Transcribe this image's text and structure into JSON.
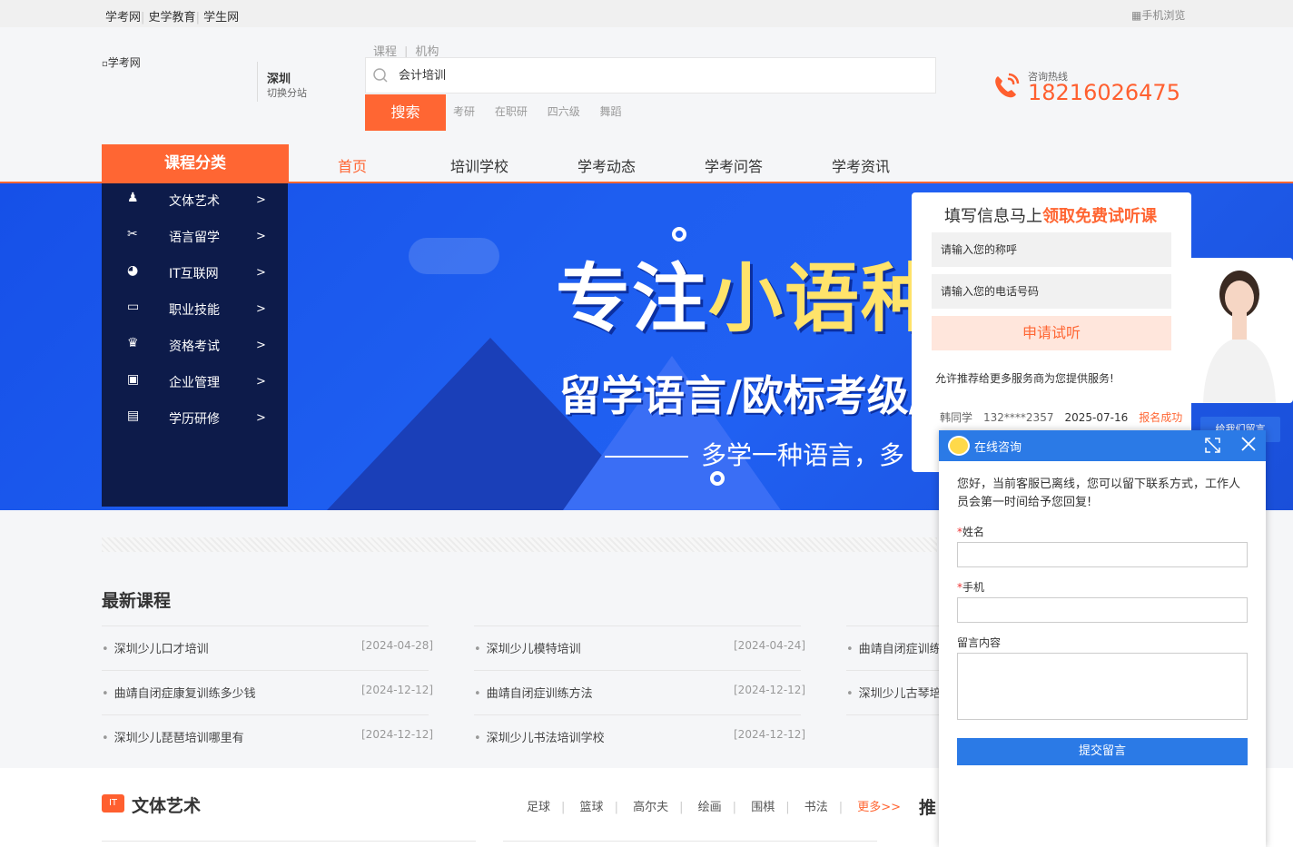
{
  "topbar": {
    "links": [
      "学考网",
      "史学教育",
      "学生网"
    ],
    "mobile": "手机浏览"
  },
  "header": {
    "logo_alt": "学考网",
    "city": "深圳",
    "city_switch": "切换分站",
    "search_tabs": [
      "课程",
      "机构"
    ],
    "search_value": "会计培训",
    "search_button": "搜索",
    "hot_keywords": [
      "考研",
      "在职研",
      "四六级",
      "舞蹈"
    ],
    "hotline_label": "咨询热线",
    "hotline_number": "18216026475"
  },
  "nav": {
    "category": "课程分类",
    "items": [
      "首页",
      "培训学校",
      "学考动态",
      "学考问答",
      "学考资讯"
    ]
  },
  "sidebar": {
    "items": [
      {
        "label": "文体艺术",
        "icon": "person-icon"
      },
      {
        "label": "语言留学",
        "icon": "tools-icon"
      },
      {
        "label": "IT互联网",
        "icon": "globe-icon"
      },
      {
        "label": "职业技能",
        "icon": "monitor-icon"
      },
      {
        "label": "资格考试",
        "icon": "certificate-icon"
      },
      {
        "label": "企业管理",
        "icon": "id-card-icon"
      },
      {
        "label": "学历研修",
        "icon": "diploma-icon"
      }
    ],
    "arrow": ">"
  },
  "banner": {
    "title_a": "专注",
    "title_b": "小语种",
    "subtitle": "留学语言/欧标考级/兴",
    "tagline": "多学一种语言，多"
  },
  "form": {
    "title_prefix": "填写信息马上",
    "title_highlight": "领取免费试听课",
    "name_placeholder": "请输入您的称呼",
    "phone_placeholder": "请输入您的电话号码",
    "apply_button": "申请试听",
    "recommend_text": "允许推荐给更多服务商为您提供服务!",
    "signup_name": "韩同学",
    "signup_phone": "132****2357",
    "signup_date": "2025-07-16",
    "signup_status": "报名成功",
    "message_button": "给我们留言"
  },
  "latest": {
    "title": "最新课程",
    "courses": [
      {
        "name": "深圳少儿口才培训",
        "date": "[2024-04-28]"
      },
      {
        "name": "深圳少儿模特培训",
        "date": "[2024-04-24]"
      },
      {
        "name": "曲靖自闭症训练",
        "date": ""
      },
      {
        "name": "曲靖自闭症康复训练多少钱",
        "date": "[2024-12-12]"
      },
      {
        "name": "曲靖自闭症训练方法",
        "date": "[2024-12-12]"
      },
      {
        "name": "深圳少儿古琴培",
        "date": ""
      },
      {
        "name": "深圳少儿琵琶培训哪里有",
        "date": "[2024-12-12]"
      },
      {
        "name": "深圳少儿书法培训学校",
        "date": "[2024-12-12]"
      }
    ]
  },
  "arts": {
    "icon_text": "IT",
    "title": "文体艺术",
    "links": [
      "足球",
      "篮球",
      "高尔夫",
      "绘画",
      "围棋",
      "书法"
    ],
    "more": "更多>>",
    "recommend_title": "推"
  },
  "chat": {
    "title": "在线咨询",
    "notice": "您好，当前客服已离线，您可以留下联系方式，工作人员会第一时间给予您回复!",
    "name_label": "姓名",
    "phone_label": "手机",
    "message_label": "留言内容",
    "required_mark": "*",
    "submit": "提交留言"
  },
  "colors": {
    "accent": "#ff6633",
    "banner": "#1e5ef0",
    "sidebar": "#0d1b4a",
    "chat": "#2b7ae6"
  }
}
